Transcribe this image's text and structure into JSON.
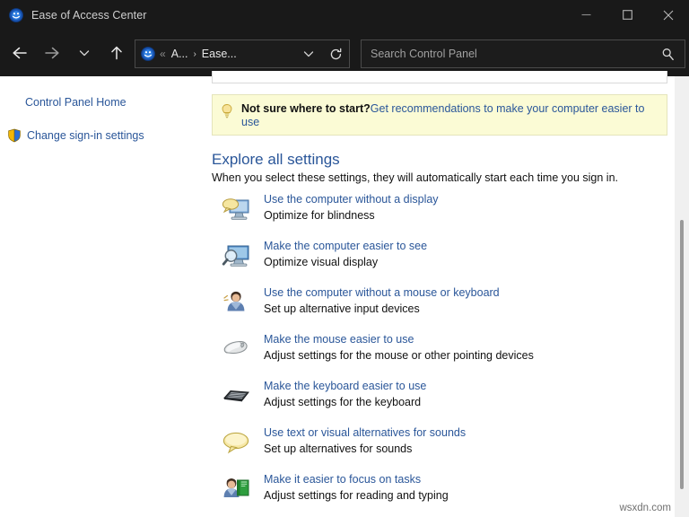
{
  "window": {
    "title": "Ease of Access Center",
    "icon": "ease-of-access-icon",
    "minimize_label": "—",
    "maximize_label": "□",
    "close_label": "✕"
  },
  "toolbar": {
    "back_label": "Back",
    "forward_label": "Forward",
    "recent_label": "Recent locations",
    "up_label": "Up one level"
  },
  "address": {
    "icon": "ease-of-access-icon",
    "overflow": "«",
    "crumb1": "A...",
    "separator": "›",
    "crumb2": "Ease...",
    "dropdown_label": "Previous locations",
    "refresh_label": "Refresh"
  },
  "search": {
    "placeholder": "Search Control Panel",
    "value": "",
    "icon": "search-icon"
  },
  "sidebar": {
    "items": [
      {
        "label": "Control Panel Home",
        "icon": null
      },
      {
        "label": "Change sign-in settings",
        "icon": "uac-shield-icon"
      }
    ]
  },
  "banner": {
    "icon": "lightbulb-icon",
    "question": "Not sure where to start?",
    "link": "Get recommendations to make your computer easier to use"
  },
  "main": {
    "heading": "Explore all settings",
    "subtitle": "When you select these settings, they will automatically start each time you sign in.",
    "settings": [
      {
        "icon": "monitor-speech-icon",
        "link": "Use the computer without a display",
        "desc": "Optimize for blindness"
      },
      {
        "icon": "monitor-magnifier-icon",
        "link": "Make the computer easier to see",
        "desc": "Optimize visual display"
      },
      {
        "icon": "person-icon",
        "link": "Use the computer without a mouse or keyboard",
        "desc": "Set up alternative input devices"
      },
      {
        "icon": "mouse-icon",
        "link": "Make the mouse easier to use",
        "desc": "Adjust settings for the mouse or other pointing devices"
      },
      {
        "icon": "keyboard-icon",
        "link": "Make the keyboard easier to use",
        "desc": "Adjust settings for the keyboard"
      },
      {
        "icon": "speech-bubble-icon",
        "link": "Use text or visual alternatives for sounds",
        "desc": "Set up alternatives for sounds"
      },
      {
        "icon": "person-book-icon",
        "link": "Make it easier to focus on tasks",
        "desc": "Adjust settings for reading and typing"
      }
    ]
  },
  "watermark": "wsxdn.com",
  "colors": {
    "titlebar_bg": "#191919",
    "link": "#2a5699",
    "banner_bg": "#fbfbd5",
    "banner_border": "#e4e4bb",
    "text": "#111111"
  }
}
